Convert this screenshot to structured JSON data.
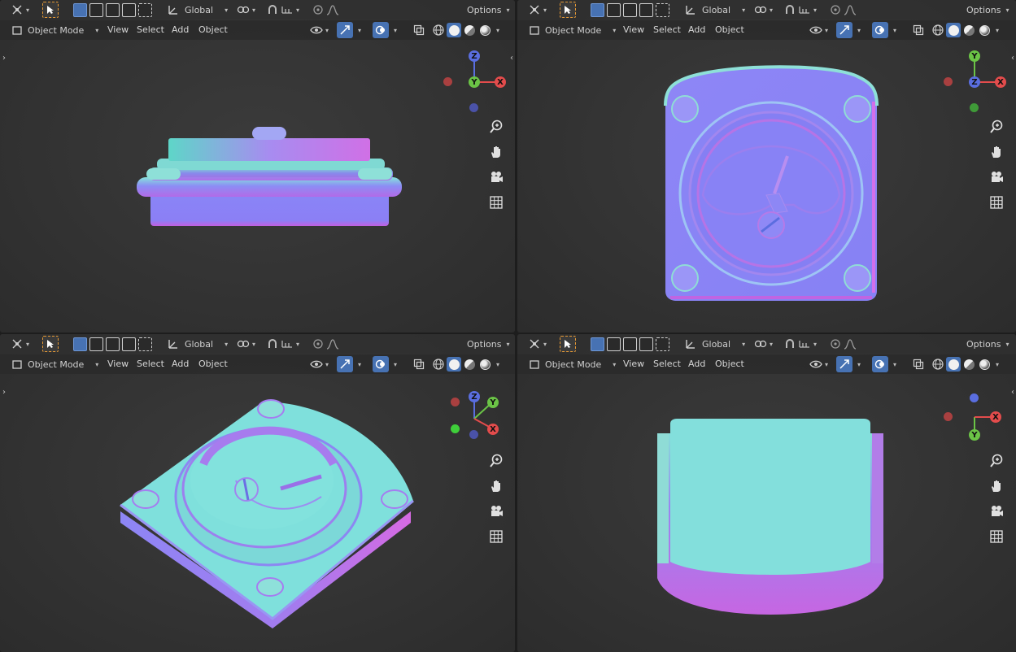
{
  "header": {
    "transform_orientation": "Global",
    "options_label": "Options",
    "mode_label": "Object Mode",
    "menu": [
      "View",
      "Select",
      "Add",
      "Object"
    ]
  },
  "icons": {
    "editor_type": "object-origin-icon",
    "select_tool": "cursor-arrow-icon",
    "orientation": "transform-axes-icon",
    "pivot": "link-pivot-icon",
    "snap": "magnet-snap-icon",
    "proportional": "falloff-icon",
    "visibility": "eye-icon",
    "gizmo": "gizmo-arrow-icon",
    "overlay": "overlay-circles-icon",
    "xray": "xray-icon",
    "zoom": "zoom-icon",
    "pan": "hand-icon",
    "camera": "camera-icon",
    "ortho": "grid-icon"
  },
  "colors": {
    "axis_x": "#e34c4c",
    "axis_y": "#6bc446",
    "axis_z": "#5a6ee0",
    "selection_orange": "#e79a35",
    "active_blue": "#4772b3"
  },
  "viewports": [
    {
      "name": "front",
      "gizmo": [
        "Z",
        "Y",
        "X"
      ]
    },
    {
      "name": "top",
      "gizmo": [
        "Y",
        "Z",
        "X"
      ]
    },
    {
      "name": "perspective",
      "gizmo": [
        "Z",
        "Y",
        "X"
      ]
    },
    {
      "name": "bottom",
      "gizmo": [
        "X",
        "Y"
      ]
    }
  ]
}
